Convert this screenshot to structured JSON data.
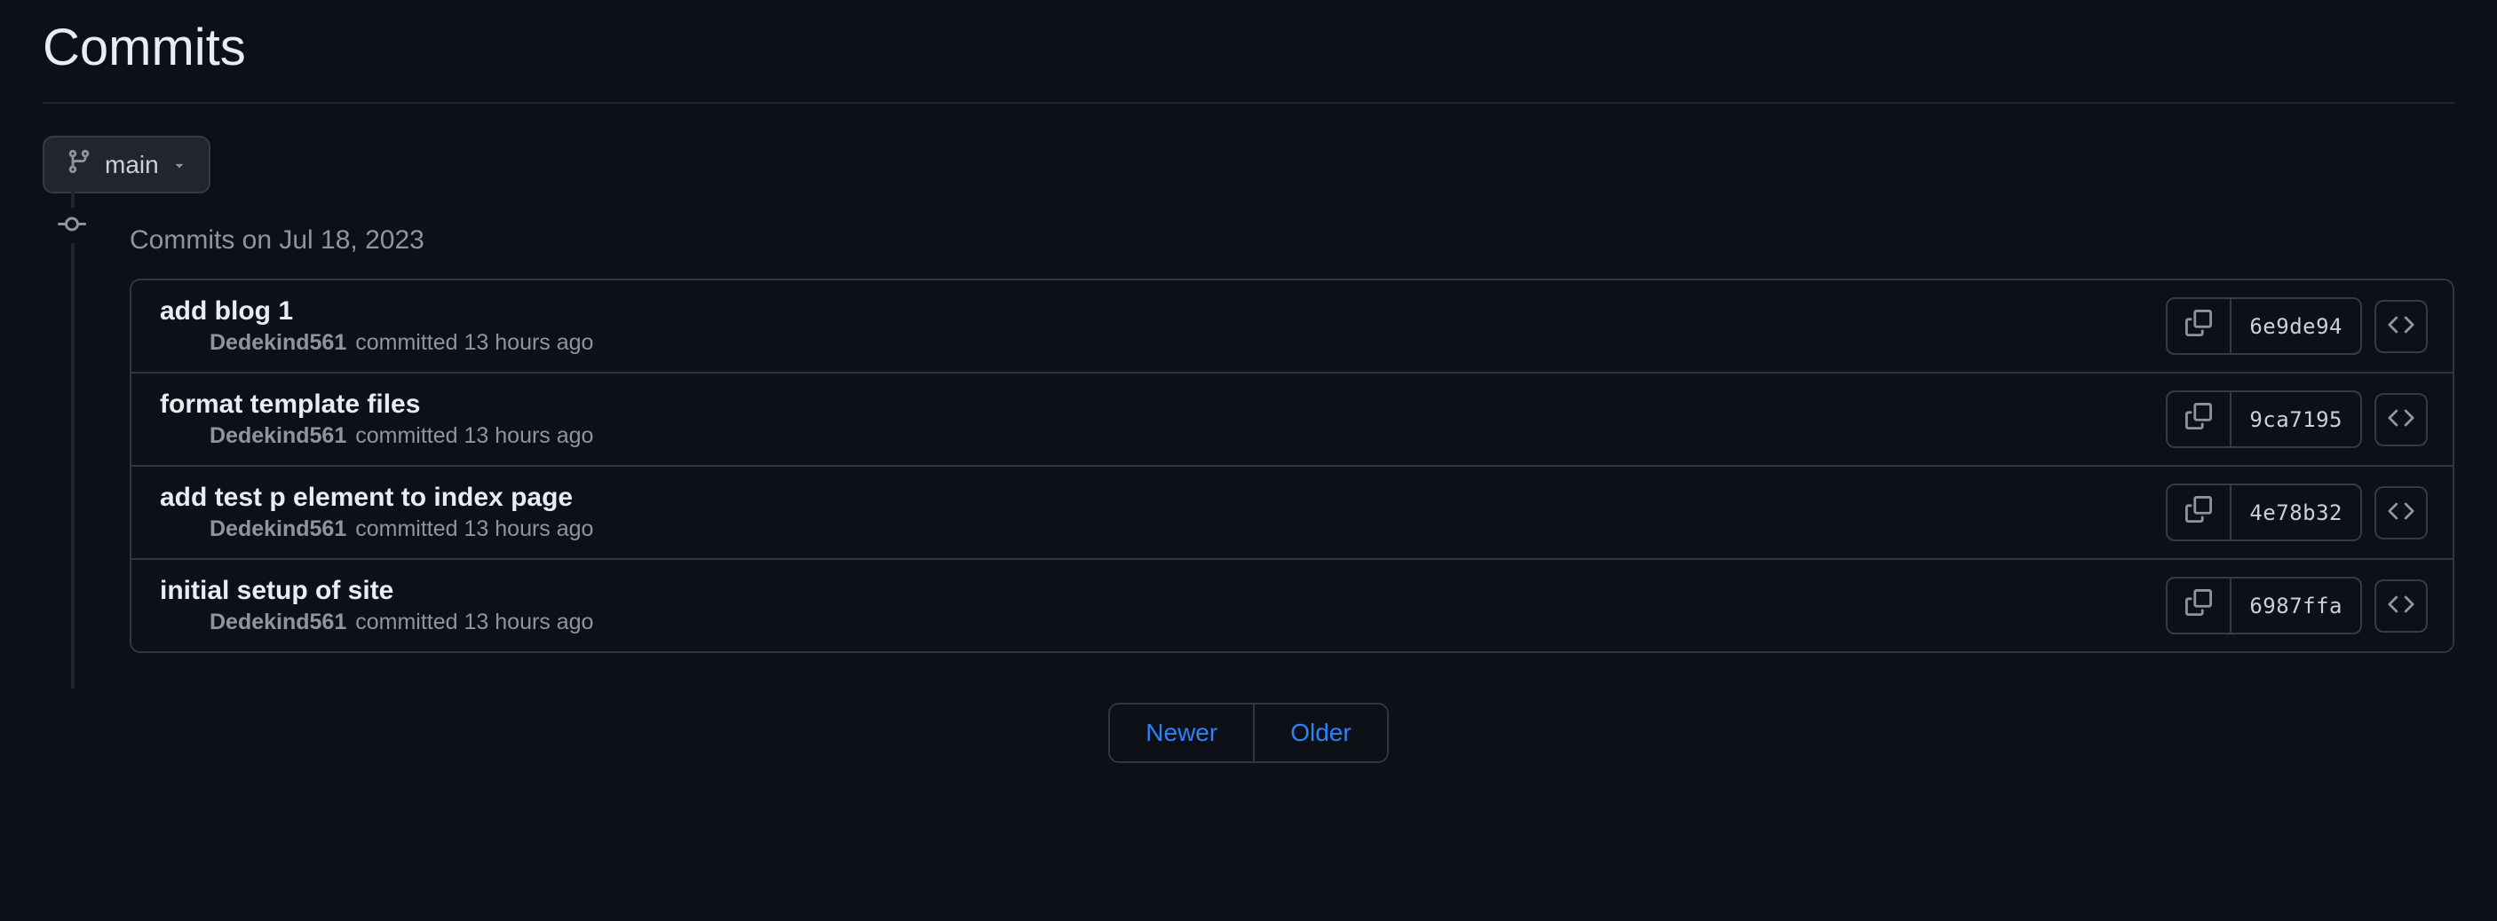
{
  "page": {
    "title": "Commits"
  },
  "branch": {
    "name": "main"
  },
  "timeline": {
    "group_label": "Commits on Jul 18, 2023"
  },
  "commits": [
    {
      "title": "add blog 1",
      "author": "Dedekind561",
      "meta": "committed 13 hours ago",
      "sha": "6e9de94"
    },
    {
      "title": "format template files",
      "author": "Dedekind561",
      "meta": "committed 13 hours ago",
      "sha": "9ca7195"
    },
    {
      "title": "add test p element to index page",
      "author": "Dedekind561",
      "meta": "committed 13 hours ago",
      "sha": "4e78b32"
    },
    {
      "title": "initial setup of site",
      "author": "Dedekind561",
      "meta": "committed 13 hours ago",
      "sha": "6987ffa"
    }
  ],
  "pagination": {
    "newer": "Newer",
    "older": "Older"
  }
}
